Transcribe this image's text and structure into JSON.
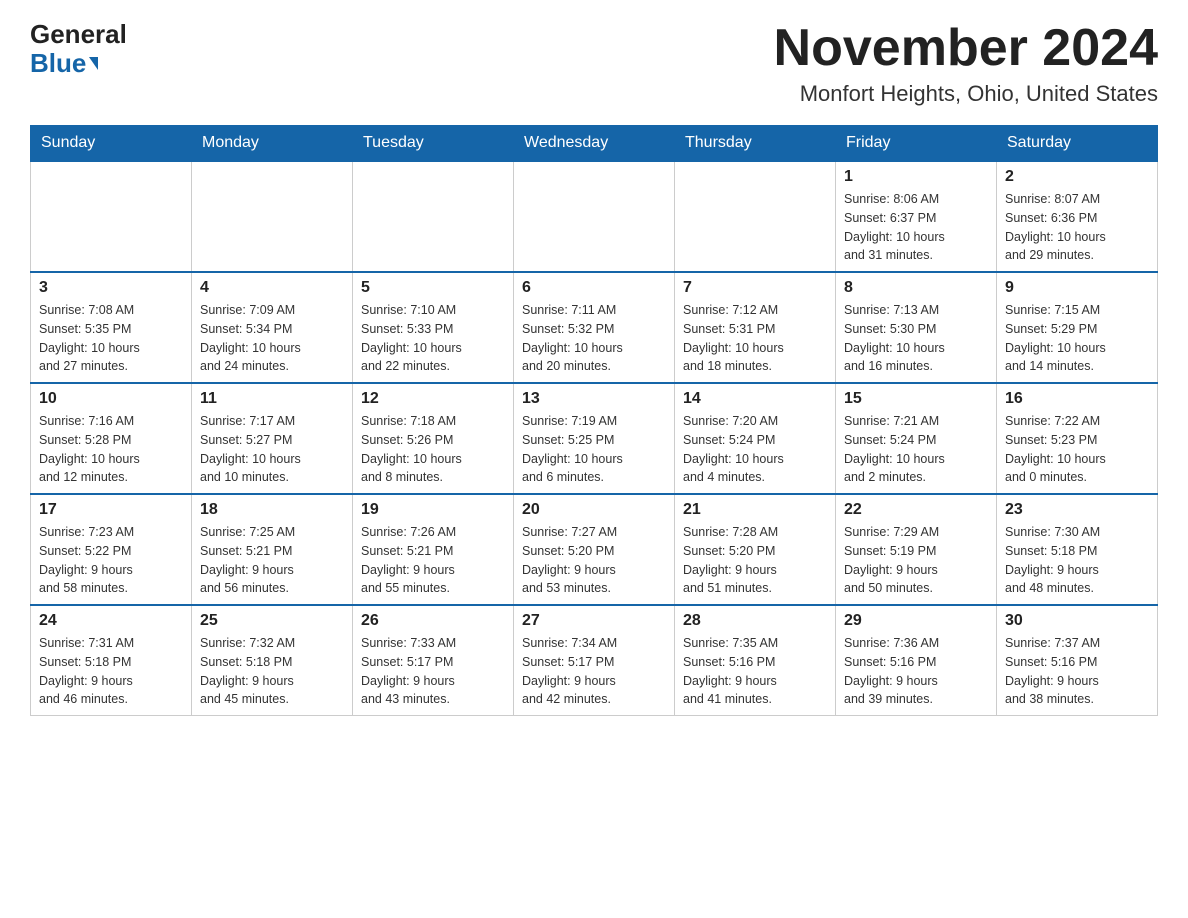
{
  "logo": {
    "line1": "General",
    "line2": "Blue"
  },
  "header": {
    "month": "November 2024",
    "location": "Monfort Heights, Ohio, United States"
  },
  "weekdays": [
    "Sunday",
    "Monday",
    "Tuesday",
    "Wednesday",
    "Thursday",
    "Friday",
    "Saturday"
  ],
  "weeks": [
    [
      {
        "day": "",
        "info": ""
      },
      {
        "day": "",
        "info": ""
      },
      {
        "day": "",
        "info": ""
      },
      {
        "day": "",
        "info": ""
      },
      {
        "day": "",
        "info": ""
      },
      {
        "day": "1",
        "info": "Sunrise: 8:06 AM\nSunset: 6:37 PM\nDaylight: 10 hours\nand 31 minutes."
      },
      {
        "day": "2",
        "info": "Sunrise: 8:07 AM\nSunset: 6:36 PM\nDaylight: 10 hours\nand 29 minutes."
      }
    ],
    [
      {
        "day": "3",
        "info": "Sunrise: 7:08 AM\nSunset: 5:35 PM\nDaylight: 10 hours\nand 27 minutes."
      },
      {
        "day": "4",
        "info": "Sunrise: 7:09 AM\nSunset: 5:34 PM\nDaylight: 10 hours\nand 24 minutes."
      },
      {
        "day": "5",
        "info": "Sunrise: 7:10 AM\nSunset: 5:33 PM\nDaylight: 10 hours\nand 22 minutes."
      },
      {
        "day": "6",
        "info": "Sunrise: 7:11 AM\nSunset: 5:32 PM\nDaylight: 10 hours\nand 20 minutes."
      },
      {
        "day": "7",
        "info": "Sunrise: 7:12 AM\nSunset: 5:31 PM\nDaylight: 10 hours\nand 18 minutes."
      },
      {
        "day": "8",
        "info": "Sunrise: 7:13 AM\nSunset: 5:30 PM\nDaylight: 10 hours\nand 16 minutes."
      },
      {
        "day": "9",
        "info": "Sunrise: 7:15 AM\nSunset: 5:29 PM\nDaylight: 10 hours\nand 14 minutes."
      }
    ],
    [
      {
        "day": "10",
        "info": "Sunrise: 7:16 AM\nSunset: 5:28 PM\nDaylight: 10 hours\nand 12 minutes."
      },
      {
        "day": "11",
        "info": "Sunrise: 7:17 AM\nSunset: 5:27 PM\nDaylight: 10 hours\nand 10 minutes."
      },
      {
        "day": "12",
        "info": "Sunrise: 7:18 AM\nSunset: 5:26 PM\nDaylight: 10 hours\nand 8 minutes."
      },
      {
        "day": "13",
        "info": "Sunrise: 7:19 AM\nSunset: 5:25 PM\nDaylight: 10 hours\nand 6 minutes."
      },
      {
        "day": "14",
        "info": "Sunrise: 7:20 AM\nSunset: 5:24 PM\nDaylight: 10 hours\nand 4 minutes."
      },
      {
        "day": "15",
        "info": "Sunrise: 7:21 AM\nSunset: 5:24 PM\nDaylight: 10 hours\nand 2 minutes."
      },
      {
        "day": "16",
        "info": "Sunrise: 7:22 AM\nSunset: 5:23 PM\nDaylight: 10 hours\nand 0 minutes."
      }
    ],
    [
      {
        "day": "17",
        "info": "Sunrise: 7:23 AM\nSunset: 5:22 PM\nDaylight: 9 hours\nand 58 minutes."
      },
      {
        "day": "18",
        "info": "Sunrise: 7:25 AM\nSunset: 5:21 PM\nDaylight: 9 hours\nand 56 minutes."
      },
      {
        "day": "19",
        "info": "Sunrise: 7:26 AM\nSunset: 5:21 PM\nDaylight: 9 hours\nand 55 minutes."
      },
      {
        "day": "20",
        "info": "Sunrise: 7:27 AM\nSunset: 5:20 PM\nDaylight: 9 hours\nand 53 minutes."
      },
      {
        "day": "21",
        "info": "Sunrise: 7:28 AM\nSunset: 5:20 PM\nDaylight: 9 hours\nand 51 minutes."
      },
      {
        "day": "22",
        "info": "Sunrise: 7:29 AM\nSunset: 5:19 PM\nDaylight: 9 hours\nand 50 minutes."
      },
      {
        "day": "23",
        "info": "Sunrise: 7:30 AM\nSunset: 5:18 PM\nDaylight: 9 hours\nand 48 minutes."
      }
    ],
    [
      {
        "day": "24",
        "info": "Sunrise: 7:31 AM\nSunset: 5:18 PM\nDaylight: 9 hours\nand 46 minutes."
      },
      {
        "day": "25",
        "info": "Sunrise: 7:32 AM\nSunset: 5:18 PM\nDaylight: 9 hours\nand 45 minutes."
      },
      {
        "day": "26",
        "info": "Sunrise: 7:33 AM\nSunset: 5:17 PM\nDaylight: 9 hours\nand 43 minutes."
      },
      {
        "day": "27",
        "info": "Sunrise: 7:34 AM\nSunset: 5:17 PM\nDaylight: 9 hours\nand 42 minutes."
      },
      {
        "day": "28",
        "info": "Sunrise: 7:35 AM\nSunset: 5:16 PM\nDaylight: 9 hours\nand 41 minutes."
      },
      {
        "day": "29",
        "info": "Sunrise: 7:36 AM\nSunset: 5:16 PM\nDaylight: 9 hours\nand 39 minutes."
      },
      {
        "day": "30",
        "info": "Sunrise: 7:37 AM\nSunset: 5:16 PM\nDaylight: 9 hours\nand 38 minutes."
      }
    ]
  ]
}
